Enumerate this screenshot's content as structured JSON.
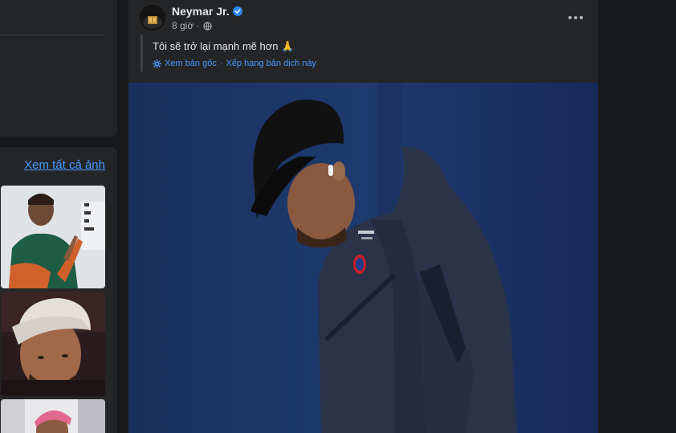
{
  "photos": {
    "see_all_label": "Xem tất cả ảnh",
    "thumbnails": [
      {
        "icon": "photo-neymar-praying"
      },
      {
        "icon": "photo-neymar-cap"
      },
      {
        "icon": "photo-neymar-pink-hair"
      }
    ]
  },
  "post": {
    "author_name": "Neymar Jr.",
    "time": "8 giờ ·",
    "text": "Tôi sẽ trở lại mạnh mẽ hơn 🙏",
    "translate": {
      "see_original": "Xem bản gốc",
      "separator": "·",
      "rate_translation": "Xếp hạng bản dịch này"
    },
    "image_icon": "photo-neymar-psg-hoodie"
  },
  "colors": {
    "background": "#18191a",
    "card": "#242526",
    "link": "#4599ff",
    "verified": "#2d88ff",
    "image_bg": "#1a2f5a"
  }
}
